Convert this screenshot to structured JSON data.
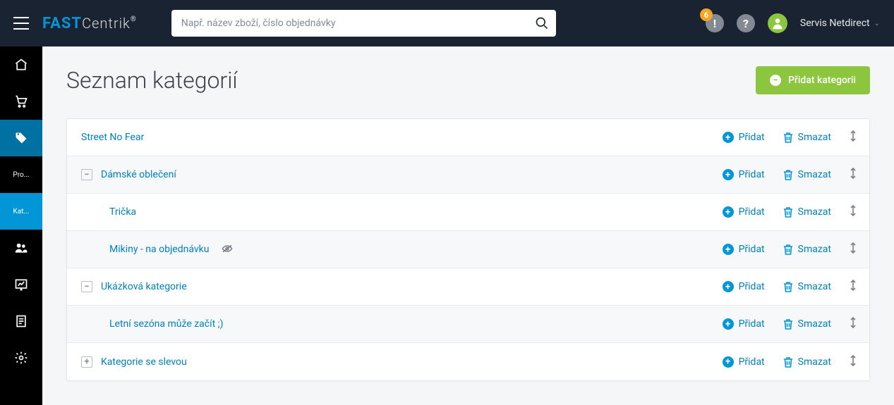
{
  "header": {
    "logo_fast": "FAST",
    "logo_centrik": "Centrik",
    "search_placeholder": "Např. název zboží, číslo objednávky",
    "notif_count": "6",
    "user_name": "Servis Netdirect"
  },
  "sidebar": {
    "items": [
      {
        "label": ""
      },
      {
        "label": ""
      },
      {
        "label": ""
      },
      {
        "label": "Pro..."
      },
      {
        "label": "Kat..."
      },
      {
        "label": ""
      },
      {
        "label": ""
      },
      {
        "label": ""
      },
      {
        "label": ""
      }
    ]
  },
  "page": {
    "title": "Seznam kategorií",
    "add_btn": "Přidat kategorii"
  },
  "actions": {
    "add": "Přidat",
    "delete": "Smazat"
  },
  "tree": [
    {
      "label": "Street No Fear",
      "indent": 0,
      "toggle": null,
      "hidden": false,
      "alt": false
    },
    {
      "label": "Dámské oblečení",
      "indent": 1,
      "toggle": "-",
      "hidden": false,
      "alt": true
    },
    {
      "label": "Trička",
      "indent": 2,
      "toggle": null,
      "hidden": false,
      "alt": false
    },
    {
      "label": "Mikiny - na objednávku",
      "indent": 2,
      "toggle": null,
      "hidden": true,
      "alt": true
    },
    {
      "label": "Ukázková kategorie",
      "indent": 1,
      "toggle": "-",
      "hidden": false,
      "alt": false
    },
    {
      "label": "Letní sezóna může začít ;)",
      "indent": 2,
      "toggle": null,
      "hidden": false,
      "alt": true
    },
    {
      "label": "Kategorie se slevou",
      "indent": 1,
      "toggle": "+",
      "hidden": false,
      "alt": false
    }
  ]
}
